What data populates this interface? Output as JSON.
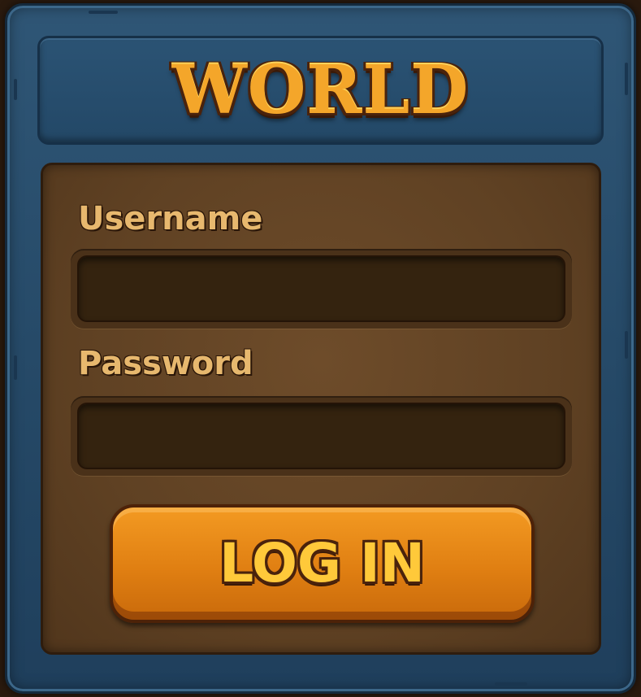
{
  "header": {
    "title": "WORLD"
  },
  "login_form": {
    "username_label": "Username",
    "username_value": "",
    "password_label": "Password",
    "password_value": "",
    "submit_label": "LOG IN"
  },
  "theme": {
    "frame_color": "#2b5374",
    "panel_color": "#5f4123",
    "title_color": "#f4a62a",
    "button_color": "#e07f12",
    "label_color": "#e7b86e"
  }
}
